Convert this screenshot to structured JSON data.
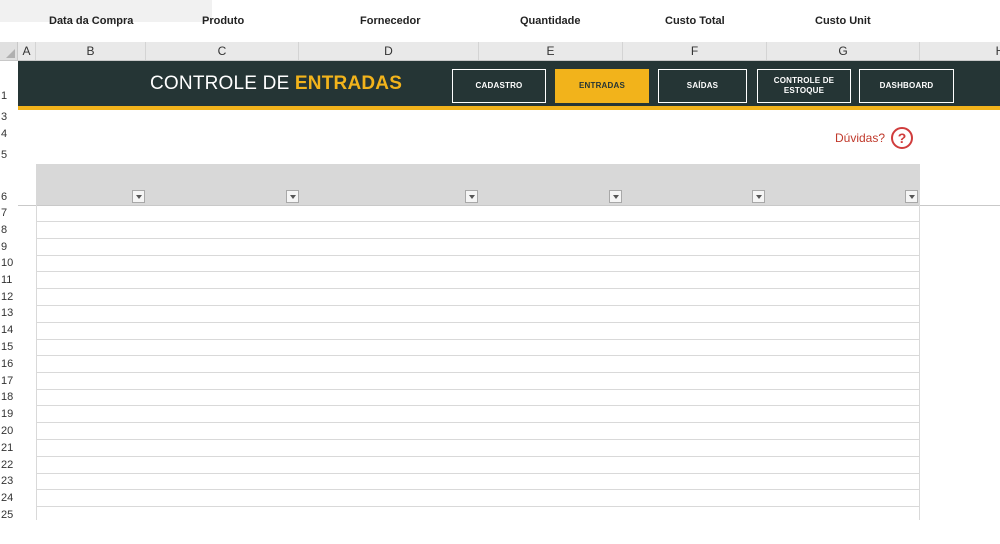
{
  "spreadsheet": {
    "columns": [
      "A",
      "B",
      "C",
      "D",
      "E",
      "F",
      "G",
      "H"
    ],
    "rows": [
      "1",
      "3",
      "4",
      "5",
      "6",
      "7",
      "8",
      "9",
      "10",
      "11",
      "12",
      "13",
      "14",
      "15",
      "16",
      "17",
      "18",
      "19",
      "20",
      "21",
      "22",
      "23",
      "24",
      "25"
    ]
  },
  "banner": {
    "title_prefix": "CONTROLE DE ",
    "title_accent": "ENTRADAS",
    "buttons": [
      {
        "label": "CADASTRO"
      },
      {
        "label": "ENTRADAS"
      },
      {
        "label": "SAÍDAS"
      },
      {
        "label": "CONTROLE DE ESTOQUE"
      },
      {
        "label": "DASHBOARD"
      }
    ]
  },
  "help": {
    "label": "Dúvidas?",
    "icon": "?"
  },
  "table": {
    "headers": [
      "Data da Compra",
      "Produto",
      "Fornecedor",
      "Quantidade",
      "Custo Total",
      "Custo Unit"
    ]
  },
  "colors": {
    "banner": "#253535",
    "accent": "#f2b31b",
    "header": "#d8d8d8",
    "help": "#c0392b"
  }
}
